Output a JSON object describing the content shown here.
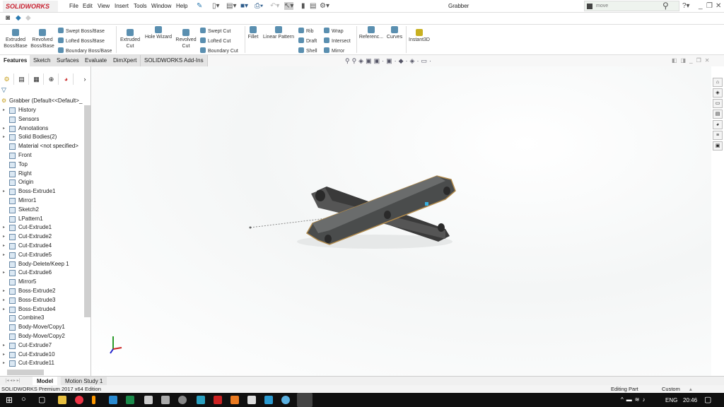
{
  "app": {
    "logo": "SOLIDWORKS",
    "document_title": "Grabber",
    "search_value": "move"
  },
  "menu": [
    "File",
    "Edit",
    "View",
    "Insert",
    "Tools",
    "Window",
    "Help"
  ],
  "ribbon": {
    "extruded_boss": "Extruded Boss/Base",
    "revolved_boss": "Revolved Boss/Base",
    "swept_boss": "Swept Boss/Base",
    "lofted_boss": "Lofted Boss/Base",
    "boundary_boss": "Boundary Boss/Base",
    "extruded_cut": "Extruded Cut",
    "hole_wizard": "Hole Wizard",
    "revolved_cut": "Revolved Cut",
    "swept_cut": "Swept Cut",
    "lofted_cut": "Lofted Cut",
    "boundary_cut": "Boundary Cut",
    "fillet": "Fillet",
    "linear_pattern": "Linear Pattern",
    "rib": "Rib",
    "draft": "Draft",
    "shell": "Shell",
    "wrap": "Wrap",
    "intersect": "Intersect",
    "mirror": "Mirror",
    "reference": "Referenc...",
    "curves": "Curves",
    "instant3d": "Instant3D"
  },
  "tabs": [
    "Features",
    "Sketch",
    "Surfaces",
    "Evaluate",
    "DimXpert",
    "SOLIDWORKS Add-Ins"
  ],
  "tree": {
    "root": "Grabber  (Default<<Default>_",
    "items": [
      {
        "label": "History",
        "arrow": true
      },
      {
        "label": "Sensors",
        "arrow": false
      },
      {
        "label": "Annotations",
        "arrow": true
      },
      {
        "label": "Solid Bodies(2)",
        "arrow": true
      },
      {
        "label": "Material <not specified>",
        "arrow": false
      },
      {
        "label": "Front",
        "arrow": false
      },
      {
        "label": "Top",
        "arrow": false
      },
      {
        "label": "Right",
        "arrow": false
      },
      {
        "label": "Origin",
        "arrow": false
      },
      {
        "label": "Boss-Extrude1",
        "arrow": true
      },
      {
        "label": "Mirror1",
        "arrow": false
      },
      {
        "label": "Sketch2",
        "arrow": false
      },
      {
        "label": "LPattern1",
        "arrow": false
      },
      {
        "label": "Cut-Extrude1",
        "arrow": true
      },
      {
        "label": "Cut-Extrude2",
        "arrow": true
      },
      {
        "label": "Cut-Extrude4",
        "arrow": true
      },
      {
        "label": "Cut-Extrude5",
        "arrow": true
      },
      {
        "label": "Body-Delete/Keep 1",
        "arrow": false
      },
      {
        "label": "Cut-Extrude6",
        "arrow": true
      },
      {
        "label": "Mirror5",
        "arrow": false
      },
      {
        "label": "Boss-Extrude2",
        "arrow": true
      },
      {
        "label": "Boss-Extrude3",
        "arrow": true
      },
      {
        "label": "Boss-Extrude4",
        "arrow": true
      },
      {
        "label": "Combine3",
        "arrow": false
      },
      {
        "label": "Body-Move/Copy1",
        "arrow": false
      },
      {
        "label": "Body-Move/Copy2",
        "arrow": false
      },
      {
        "label": "Cut-Extrude7",
        "arrow": true
      },
      {
        "label": "Cut-Extrude10",
        "arrow": true
      },
      {
        "label": "Cut-Extrude11",
        "arrow": true
      }
    ]
  },
  "bottom_tabs": [
    "Model",
    "Motion Study 1"
  ],
  "status": {
    "edition": "SOLIDWORKS Premium 2017 x64 Edition",
    "mode": "Editing Part",
    "units": "Custom"
  },
  "taskbar": {
    "lang": "ENG",
    "time": "20:46"
  }
}
